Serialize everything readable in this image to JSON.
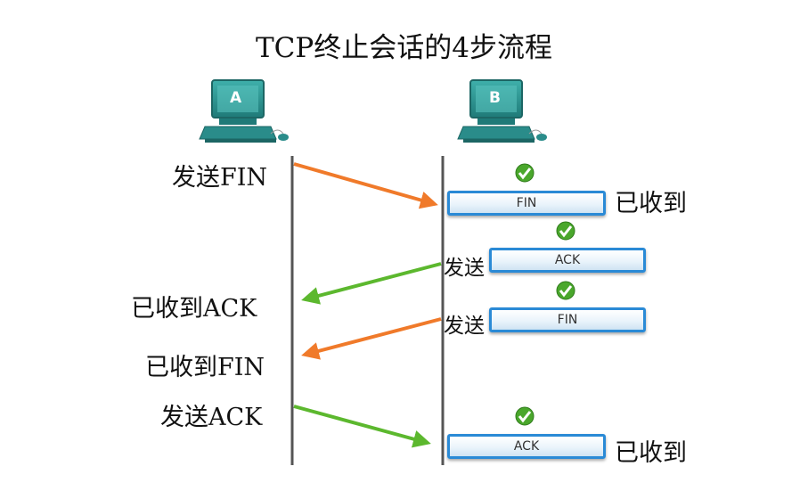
{
  "title": "TCP终止会话的4步流程",
  "hosts": {
    "a": "A",
    "b": "B"
  },
  "left_labels": {
    "send_fin": "发送FIN",
    "recv_ack": "已收到ACK",
    "recv_fin": "已收到FIN",
    "send_ack": "发送ACK"
  },
  "right_labels": {
    "recv_fin": "已收到",
    "send_ack": "发送",
    "send_fin": "发送",
    "recv_ack": "已收到"
  },
  "segments": {
    "fin_1": "FIN",
    "ack_1": "ACK",
    "fin_2": "FIN",
    "ack_2": "ACK"
  },
  "colors": {
    "orange_arrow": "#f07a2a",
    "green_arrow": "#5cb82e",
    "computer": "#2a8c8a",
    "segment_border": "#2a8ad6",
    "check": "#4aa72c",
    "timeline": "#555555"
  }
}
